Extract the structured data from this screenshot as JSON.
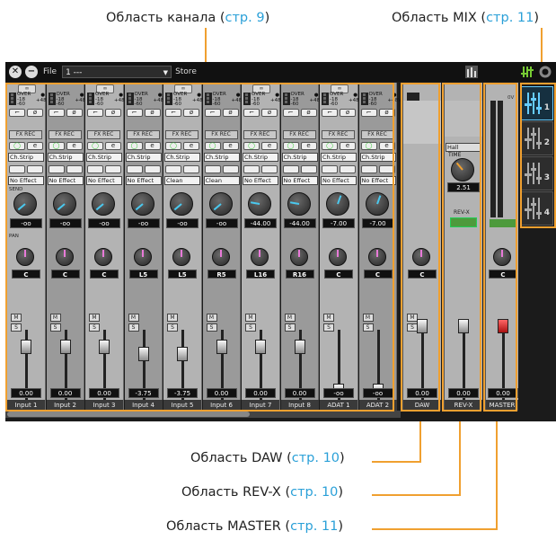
{
  "callouts": {
    "channel": {
      "text": "Область канала (",
      "page": "стр. 9",
      "close": ")"
    },
    "mix": {
      "text": "Область MIX (",
      "page": "стр. 11",
      "close": ")"
    },
    "daw": {
      "text": "Область DAW (",
      "page": "стр. 10",
      "close": ")"
    },
    "revx": {
      "text": "Область REV-X (",
      "page": "стр. 10",
      "close": ")"
    },
    "master": {
      "text": "Область MASTER (",
      "page": "стр. 11",
      "close": ")"
    }
  },
  "toolbar": {
    "file_label": "File",
    "file_value": "1  ---",
    "store_label": "Store"
  },
  "channels": [
    {
      "name": "Input 1",
      "dyn": "Ch.Strip",
      "effect": "No Effect",
      "send": "-oo",
      "pan": "C",
      "fader": "0.00",
      "fxrec": "FX REC",
      "level": 0.76
    },
    {
      "name": "Input 2",
      "dyn": "Ch.Strip",
      "effect": "No Effect",
      "send": "-oo",
      "pan": "C",
      "fader": "0.00",
      "fxrec": "FX REC",
      "level": 0.76
    },
    {
      "name": "Input 3",
      "dyn": "Ch.Strip",
      "effect": "No Effect",
      "send": "-oo",
      "pan": "C",
      "fader": "0.00",
      "fxrec": "FX REC",
      "level": 0.76
    },
    {
      "name": "Input 4",
      "dyn": "Ch.Strip",
      "effect": "No Effect",
      "send": "-oo",
      "pan": "L5",
      "fader": "-3.75",
      "fxrec": "FX REC",
      "level": 0.66
    },
    {
      "name": "Input 5",
      "dyn": "Ch.Strip",
      "effect": "Clean",
      "send": "-oo",
      "pan": "L5",
      "fader": "-3.75",
      "fxrec": "FX REC",
      "level": 0.66
    },
    {
      "name": "Input 6",
      "dyn": "Ch.Strip",
      "effect": "Clean",
      "send": "-oo",
      "pan": "R5",
      "fader": "0.00",
      "fxrec": "FX REC",
      "level": 0.76
    },
    {
      "name": "Input 7",
      "dyn": "Ch.Strip",
      "effect": "No Effect",
      "send": "-44.00",
      "pan": "L16",
      "fader": "0.00",
      "fxrec": "FX REC",
      "level": 0.76
    },
    {
      "name": "Input 8",
      "dyn": "Ch.Strip",
      "effect": "No Effect",
      "send": "-44.00",
      "pan": "R16",
      "fader": "0.00",
      "fxrec": "FX REC",
      "level": 0.76
    },
    {
      "name": "ADAT 1",
      "dyn": "Ch.Strip",
      "effect": "No Effect",
      "send": "-7.00",
      "pan": "C",
      "fader": "-oo",
      "fxrec": "FX REC",
      "level": 0.15
    },
    {
      "name": "ADAT 2",
      "dyn": "Ch.Strip",
      "effect": "No Effect",
      "send": "-7.00",
      "pan": "C",
      "fader": "-oo",
      "fxrec": "FX REC",
      "level": 0.15
    }
  ],
  "strip_labels": {
    "over": "OVER",
    "m18": "-18",
    "m60": "-60",
    "phantom": "+48V",
    "send_row": "SEND",
    "pan_row": "PAN",
    "mute": "M",
    "solo": "S",
    "link": "∞"
  },
  "daw": {
    "name": "DAW",
    "pan": "C",
    "fader": "0.00"
  },
  "revx": {
    "name": "REV-X",
    "type": "Hall",
    "time_label": "TIME",
    "time_value": "2.51",
    "section_label": "REV-X",
    "fader": "0.00"
  },
  "master": {
    "name": "MASTER",
    "pan": "C",
    "fader": "0.00",
    "meter_top": "0V"
  },
  "mix_buttons": [
    {
      "num": "1"
    },
    {
      "num": "2"
    },
    {
      "num": "3"
    },
    {
      "num": "4"
    }
  ],
  "colors": {
    "accent_callout": "#f0a030",
    "link_blue": "#2aa0d8",
    "mix_active": "#6cf"
  }
}
